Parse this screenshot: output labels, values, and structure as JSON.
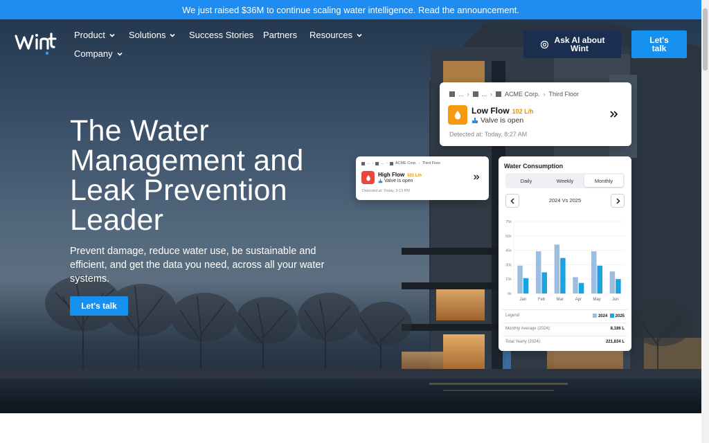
{
  "announcement": "We just raised $36M to continue scaling water intelligence. Read the announcement.",
  "brand": {
    "logo_text": "wint",
    "accent": "#1691f0"
  },
  "nav": {
    "items": [
      {
        "label": "Product",
        "dropdown": true
      },
      {
        "label": "Solutions",
        "dropdown": true
      },
      {
        "label": "Success Stories",
        "dropdown": false
      },
      {
        "label": "Partners",
        "dropdown": false
      },
      {
        "label": "Resources",
        "dropdown": true
      },
      {
        "label": "Company",
        "dropdown": true
      }
    ],
    "ask_ai": {
      "line1": "Ask AI about",
      "line2": "Wint"
    },
    "talk": {
      "line1": "Let's",
      "line2": "talk"
    }
  },
  "hero": {
    "title": "The Water Management and Leak Prevention Leader",
    "subtitle": "Prevent damage, reduce water use, be sustainable and efficient, and get the data you need, across all your water systems.",
    "cta": "Let's talk"
  },
  "alert_low": {
    "breadcrumb": [
      "...",
      "...",
      "ACME Corp.",
      "Third Floor"
    ],
    "title": "Low Flow",
    "rate": "102 L/h",
    "status": "Valve is open",
    "detected": "Detected at: Today, 8:27 AM",
    "icon_color": "#f59a10"
  },
  "alert_high": {
    "breadcrumb": [
      "...",
      "...",
      "ACME Corp.",
      "Third Floor"
    ],
    "title": "High Flow",
    "rate": "531 L/h",
    "status": "Valve is open",
    "detected": "Detected at: Today, 3:13 PM",
    "icon_color": "#e9473c"
  },
  "consumption": {
    "title": "Water Consumption",
    "tabs": [
      "Daily",
      "Weekly",
      "Monthly"
    ],
    "active_tab": "Monthly",
    "period": "2024 Vs 2025",
    "legend_label": "Legend",
    "monthly_avg_label": "Monthly Average (2024):",
    "monthly_avg_value": "8,186 L",
    "total_label": "Total Yearly (2024):",
    "total_value": "221,834 L"
  },
  "chart_data": {
    "type": "bar",
    "categories": [
      "Jan",
      "Feb",
      "Mar",
      "Apr",
      "May",
      "Jun"
    ],
    "series": [
      {
        "name": "2024",
        "values": [
          29,
          44,
          51,
          17,
          44,
          23
        ],
        "color": "#9dbde0"
      },
      {
        "name": "2025",
        "values": [
          16,
          22,
          37,
          11,
          29,
          15
        ],
        "color": "#1aa3e0"
      }
    ],
    "y_ticks": [
      "0k",
      "15k",
      "30k",
      "45k",
      "60k",
      "75k"
    ],
    "ylim": [
      0,
      75
    ],
    "grid": true,
    "legend": "bottom-right"
  }
}
